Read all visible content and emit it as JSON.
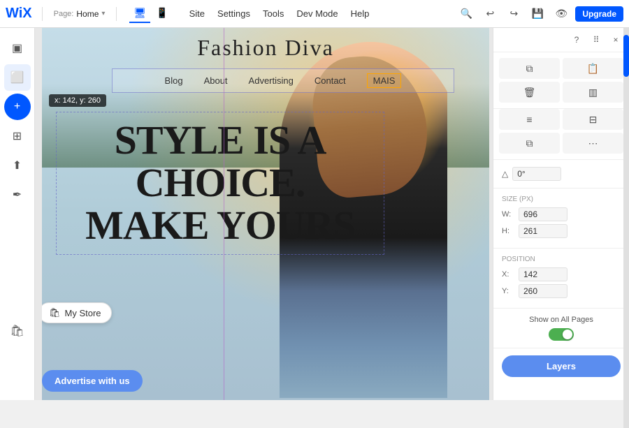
{
  "app": {
    "logo": "WiX",
    "page_label": "Page:",
    "page_name": "Home",
    "menu_items": [
      "Site",
      "Settings",
      "Tools",
      "Dev Mode",
      "Help",
      "Upgrade"
    ],
    "view_modes": [
      "desktop",
      "mobile"
    ],
    "upgrade_label": "Upgrade"
  },
  "site": {
    "title": "Fashion Diva",
    "nav": {
      "items": [
        "Blog",
        "About",
        "Advertising",
        "Contact",
        "MAIS"
      ]
    },
    "hero": {
      "line1": "STYLE IS A",
      "line2": "CHOICE.",
      "line3": "MAKE YOURS"
    },
    "coordinate_tooltip": "x: 142, y: 260",
    "my_store_label": "My Store",
    "advertise_label": "Advertise with us"
  },
  "right_panel": {
    "question_icon": "?",
    "grid_icon": "⠿",
    "close_icon": "×",
    "icons_row1": [
      "copy",
      "paste",
      "trash",
      "group"
    ],
    "icons_row2": [
      "align",
      "distribute",
      "layers_icon",
      "more"
    ],
    "angle_label": "0°",
    "size_section": {
      "title": "Size (px)",
      "width_label": "W:",
      "width_value": "696",
      "height_label": "H:",
      "height_value": "261"
    },
    "position_section": {
      "title": "Position",
      "x_label": "X:",
      "x_value": "142",
      "y_label": "Y:",
      "y_value": "260"
    },
    "show_on_all_pages": {
      "label": "Show on All Pages",
      "enabled": true
    },
    "layers_label": "Layers"
  },
  "sidebar": {
    "items": [
      {
        "name": "elements",
        "icon": "▣"
      },
      {
        "name": "pages",
        "icon": "⬜"
      },
      {
        "name": "add",
        "icon": "+"
      },
      {
        "name": "apps",
        "icon": "⊞"
      },
      {
        "name": "upload",
        "icon": "↑"
      },
      {
        "name": "pen",
        "icon": "✒"
      },
      {
        "name": "store",
        "icon": "🛍"
      }
    ]
  }
}
